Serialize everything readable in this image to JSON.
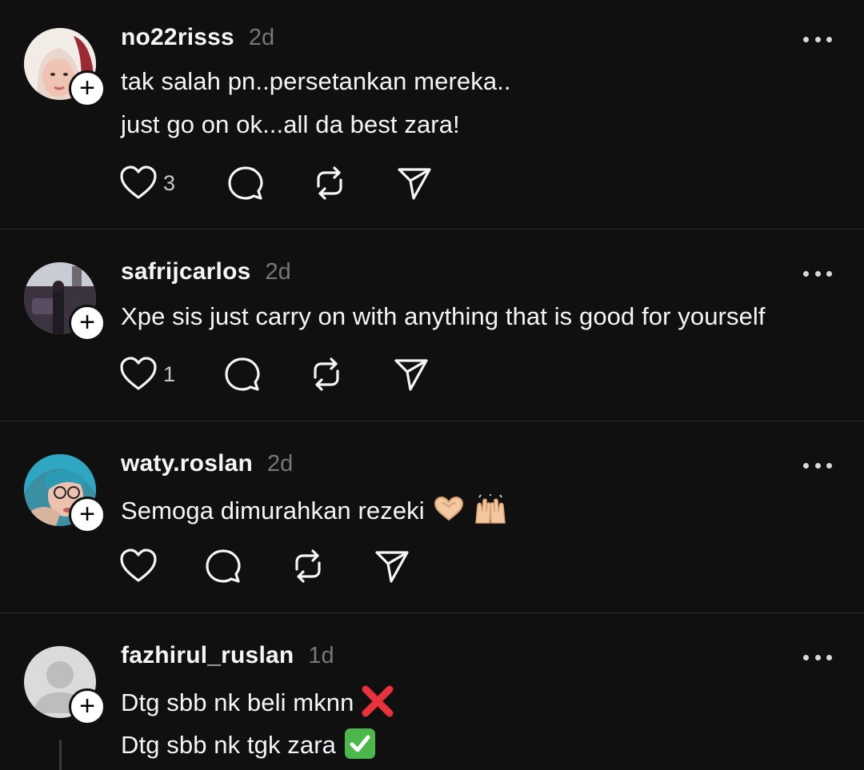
{
  "posts": [
    {
      "username": "no22risss",
      "time": "2d",
      "lines": [
        "tak salah pn..persetankan mereka..",
        "just go on ok...all da best zara!"
      ],
      "likes": "3"
    },
    {
      "username": "safrijcarlos",
      "time": "2d",
      "lines": [
        "Xpe sis just carry on with anything that is good for yourself"
      ],
      "likes": "1"
    },
    {
      "username": "waty.roslan",
      "time": "2d",
      "lines": [
        "Semoga dimurahkan rezeki"
      ],
      "likes": ""
    },
    {
      "username": "fazhirul_ruslan",
      "time": "1d",
      "lines": [
        "Dtg sbb nk beli mknn",
        "Dtg sbb nk tgk zara"
      ],
      "likes": ""
    }
  ],
  "icons": {
    "more": "more-options-icon",
    "like": "heart-icon",
    "reply": "comment-icon",
    "repost": "repost-icon",
    "share": "send-icon",
    "follow": "plus-icon"
  },
  "colors": {
    "background": "#101010",
    "text": "#f3f5f7",
    "secondary": "#777777",
    "divider": "#2a2a2a"
  }
}
